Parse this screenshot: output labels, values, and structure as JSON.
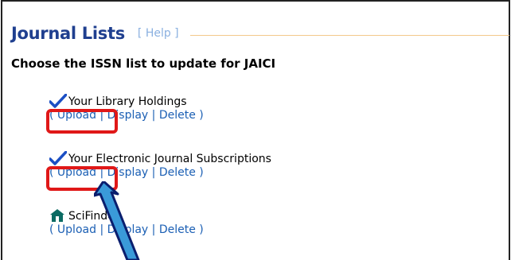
{
  "header": {
    "title": "Journal Lists",
    "help_label": "[ Help ]"
  },
  "subtitle": "Choose the ISSN list to update for JAICI",
  "lists": [
    {
      "name": "Your Library Holdings",
      "icon": "checkmark-icon",
      "actions": {
        "open": "(",
        "upload": "Upload",
        "sep1": "|",
        "display": "Display",
        "sep2": "|",
        "delete": "Delete",
        "close": ")"
      }
    },
    {
      "name": "Your Electronic Journal Subscriptions",
      "icon": "checkmark-icon",
      "actions": {
        "open": "(",
        "upload": "Upload",
        "sep1": "|",
        "display": "Display",
        "sep2": "|",
        "delete": "Delete",
        "close": ")"
      }
    },
    {
      "name": "SciFinder",
      "icon": "home-icon",
      "actions": {
        "open": "(",
        "upload": "Upload",
        "sep1": "|",
        "display": "Display",
        "sep2": "|",
        "delete": "Delete",
        "close": ")"
      }
    }
  ],
  "colors": {
    "title": "#1f3f8f",
    "link": "#1b5fb4",
    "help": "#8ab0e0",
    "highlight": "#e01818",
    "arrow": "#3a9ad9"
  }
}
